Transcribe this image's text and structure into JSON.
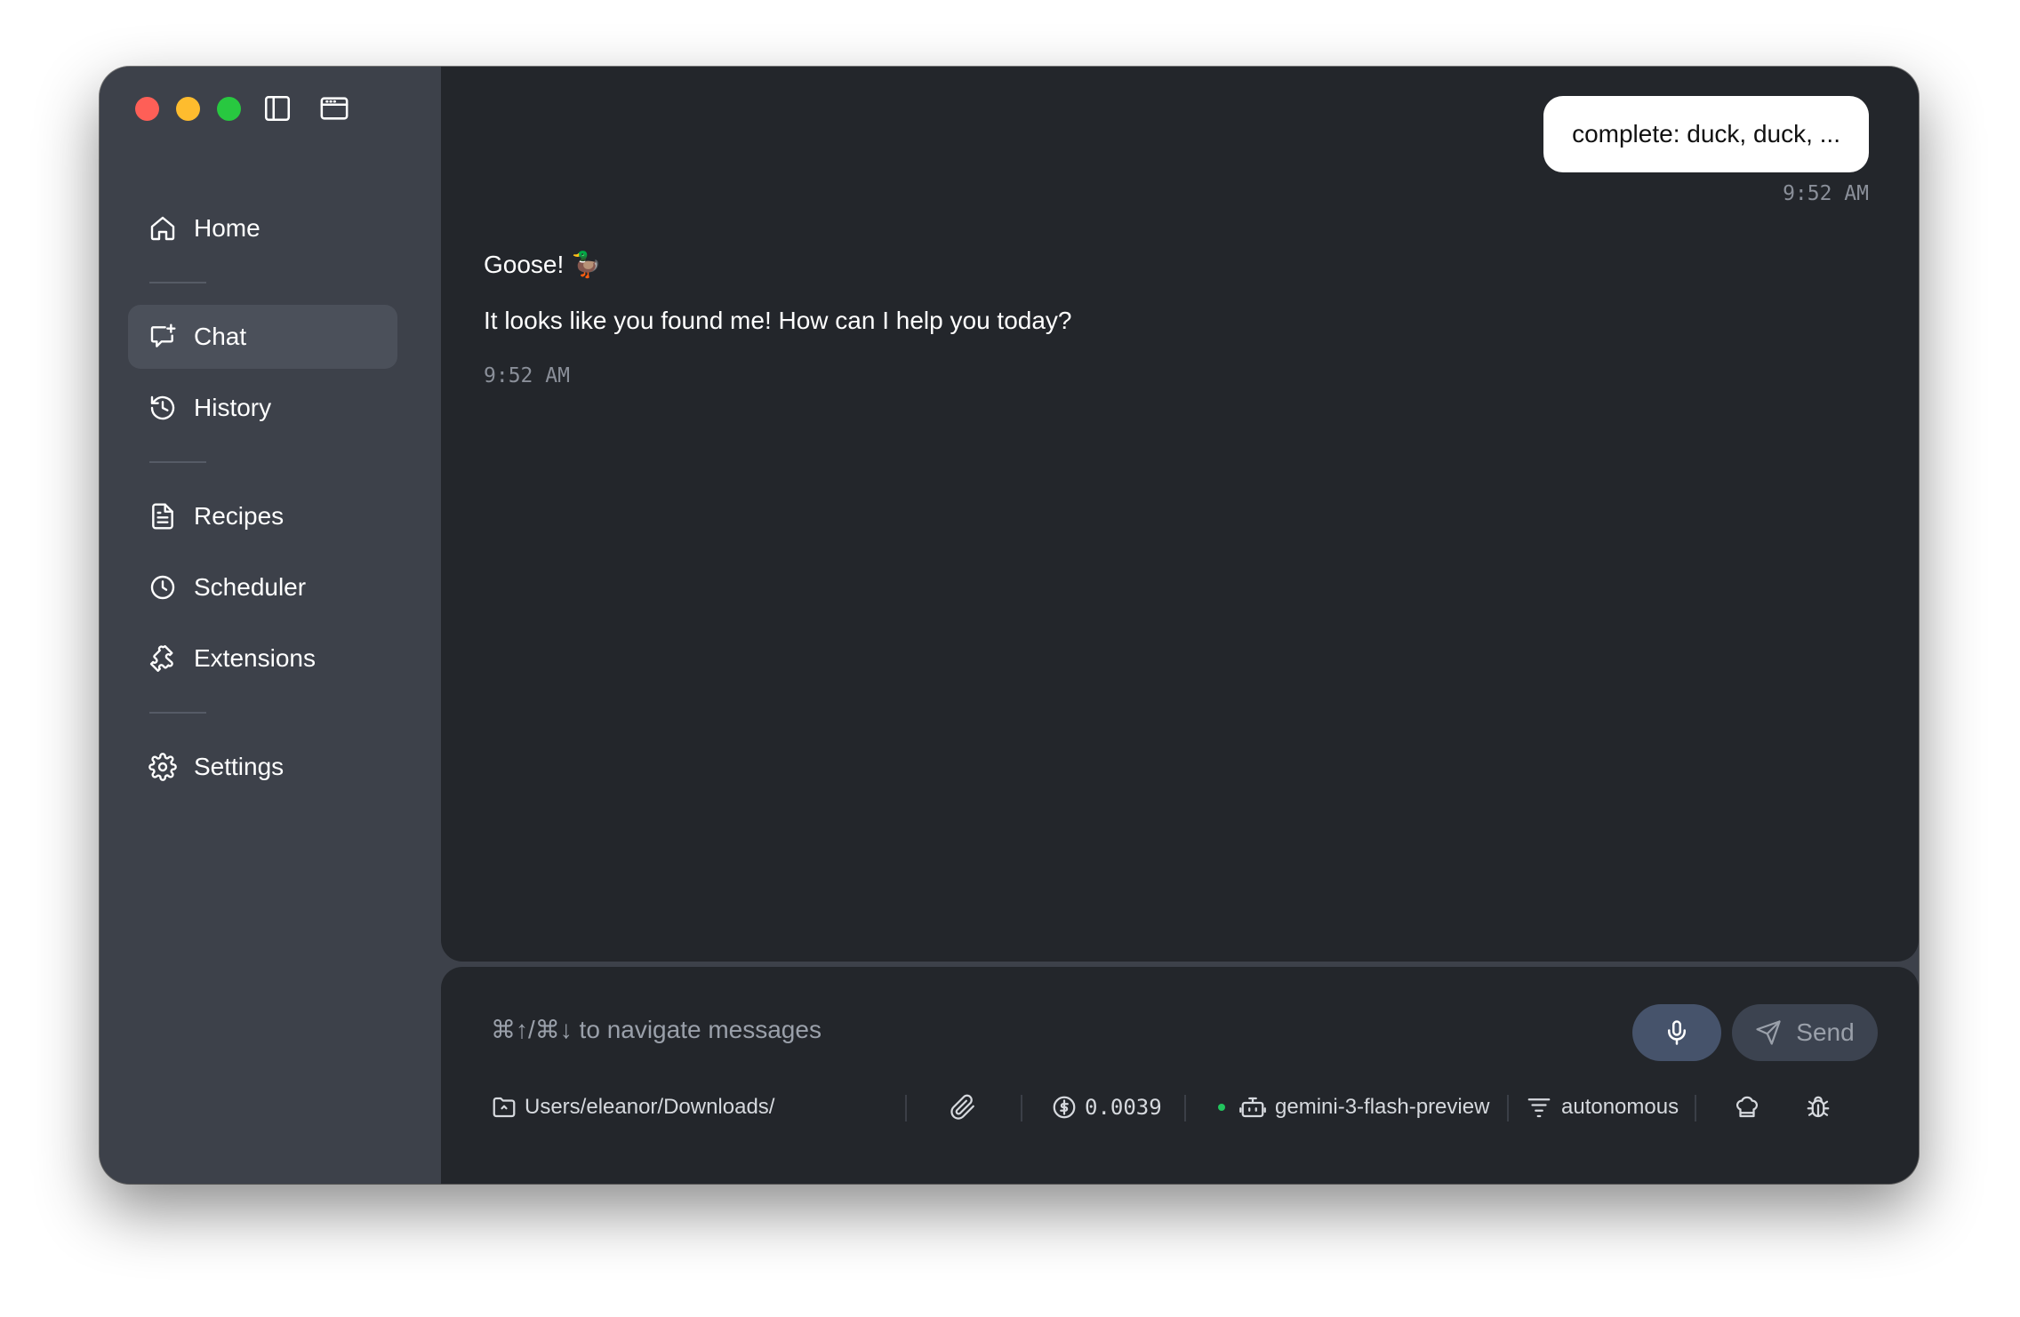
{
  "window": {
    "controls": [
      "close",
      "minimize",
      "zoom"
    ],
    "toolbar_icons": [
      "sidebar-toggle-icon",
      "window-icon"
    ]
  },
  "sidebar": {
    "items": [
      {
        "label": "Home",
        "icon": "home-icon",
        "active": false
      },
      {
        "label": "Chat",
        "icon": "chat-icon",
        "active": true
      },
      {
        "label": "History",
        "icon": "history-icon",
        "active": false
      },
      {
        "label": "Recipes",
        "icon": "recipes-icon",
        "active": false
      },
      {
        "label": "Scheduler",
        "icon": "clock-icon",
        "active": false
      },
      {
        "label": "Extensions",
        "icon": "puzzle-icon",
        "active": false
      },
      {
        "label": "Settings",
        "icon": "gear-icon",
        "active": false
      }
    ]
  },
  "chat": {
    "user_message": {
      "text": "complete: duck, duck, ...",
      "time": "9:52 AM"
    },
    "assistant_message": {
      "line1": "Goose! 🦆",
      "line2": "It looks like you found me! How can I help you today?",
      "time": "9:52 AM"
    }
  },
  "composer": {
    "placeholder": "⌘↑/⌘↓ to navigate messages",
    "send_label": "Send",
    "working_dir": "Users/eleanor/Downloads/",
    "cost": "0.0039",
    "model": "gemini-3-flash-preview",
    "mode": "autonomous"
  },
  "colors": {
    "sidebar_bg": "#3d414a",
    "main_bg": "#23262b",
    "mic_button": "#46536b",
    "status_dot": "#22c55e"
  }
}
